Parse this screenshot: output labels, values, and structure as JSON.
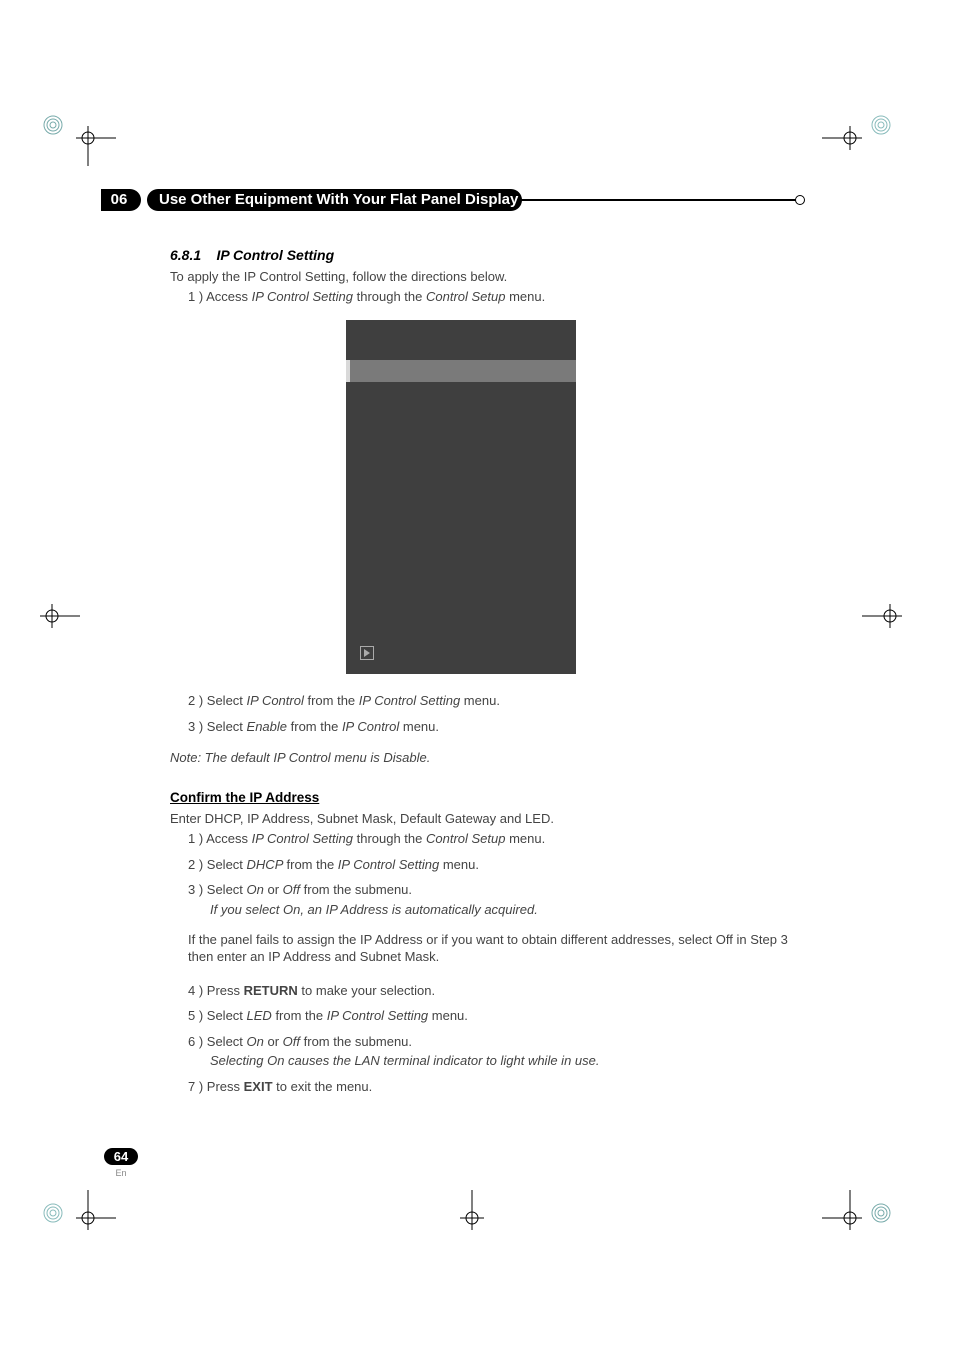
{
  "chapter": {
    "number": "06",
    "title": "Use Other Equipment With Your Flat Panel Display"
  },
  "section": {
    "heading_num": "6.8.1",
    "heading_text": "IP Control Setting",
    "intro": "To apply the IP Control Setting, follow the directions below.",
    "step1_prefix": "1 ) Access ",
    "step1_it1": "IP Control Setting",
    "step1_mid": " through the ",
    "step1_it2": "Control Setup",
    "step1_suffix": " menu.",
    "step2_prefix": "2 ) Select ",
    "step2_it1": "IP Control",
    "step2_mid": " from the ",
    "step2_it2": "IP Control Setting",
    "step2_suffix": " menu.",
    "step3_prefix": "3 ) Select ",
    "step3_it1": "Enable",
    "step3_mid": " from the ",
    "step3_it2": "IP Control",
    "step3_suffix": " menu.",
    "note": "Note: The default IP Control menu is Disable."
  },
  "confirm": {
    "heading": "Confirm the IP Address",
    "intro": "Enter DHCP, IP Address, Subnet Mask, Default Gateway and LED.",
    "s1_prefix": "1 ) Access ",
    "s1_it1": "IP Control Setting",
    "s1_mid": " through the ",
    "s1_it2": "Control Setup",
    "s1_suffix": " menu.",
    "s2_prefix": "2 ) Select ",
    "s2_it1": "DHCP ",
    "s2_mid": " from the ",
    "s2_it2": "IP Control Setting",
    "s2_suffix": " menu.",
    "s3_prefix": "3 ) Select ",
    "s3_it1": "On",
    "s3_mid1": " or ",
    "s3_it2": "Off ",
    "s3_suffix": " from the submenu.",
    "s3_note": "If you select On, an IP Address is automatically acquired.",
    "para": "If the panel fails to assign the IP Address or if you want to obtain different addresses, select Off in Step 3 then enter an IP Address and Subnet Mask.",
    "s4_prefix": "4 ) Press ",
    "s4_bold": "RETURN",
    "s4_suffix": " to make your selection.",
    "s5_prefix": "5 ) Select ",
    "s5_it1": "LED",
    "s5_mid": " from the ",
    "s5_it2": "IP Control Setting",
    "s5_suffix": " menu.",
    "s6_prefix": "6 ) Select ",
    "s6_it1": "On",
    "s6_mid1": " or ",
    "s6_it2": "Off ",
    "s6_suffix": " from the submenu.",
    "s6_note": "Selecting On causes the LAN terminal indicator to light while in use.",
    "s7_prefix": "7 ) Press ",
    "s7_bold": "EXIT",
    "s7_suffix": " to exit the menu."
  },
  "footer": {
    "page": "64",
    "lang": "En"
  }
}
